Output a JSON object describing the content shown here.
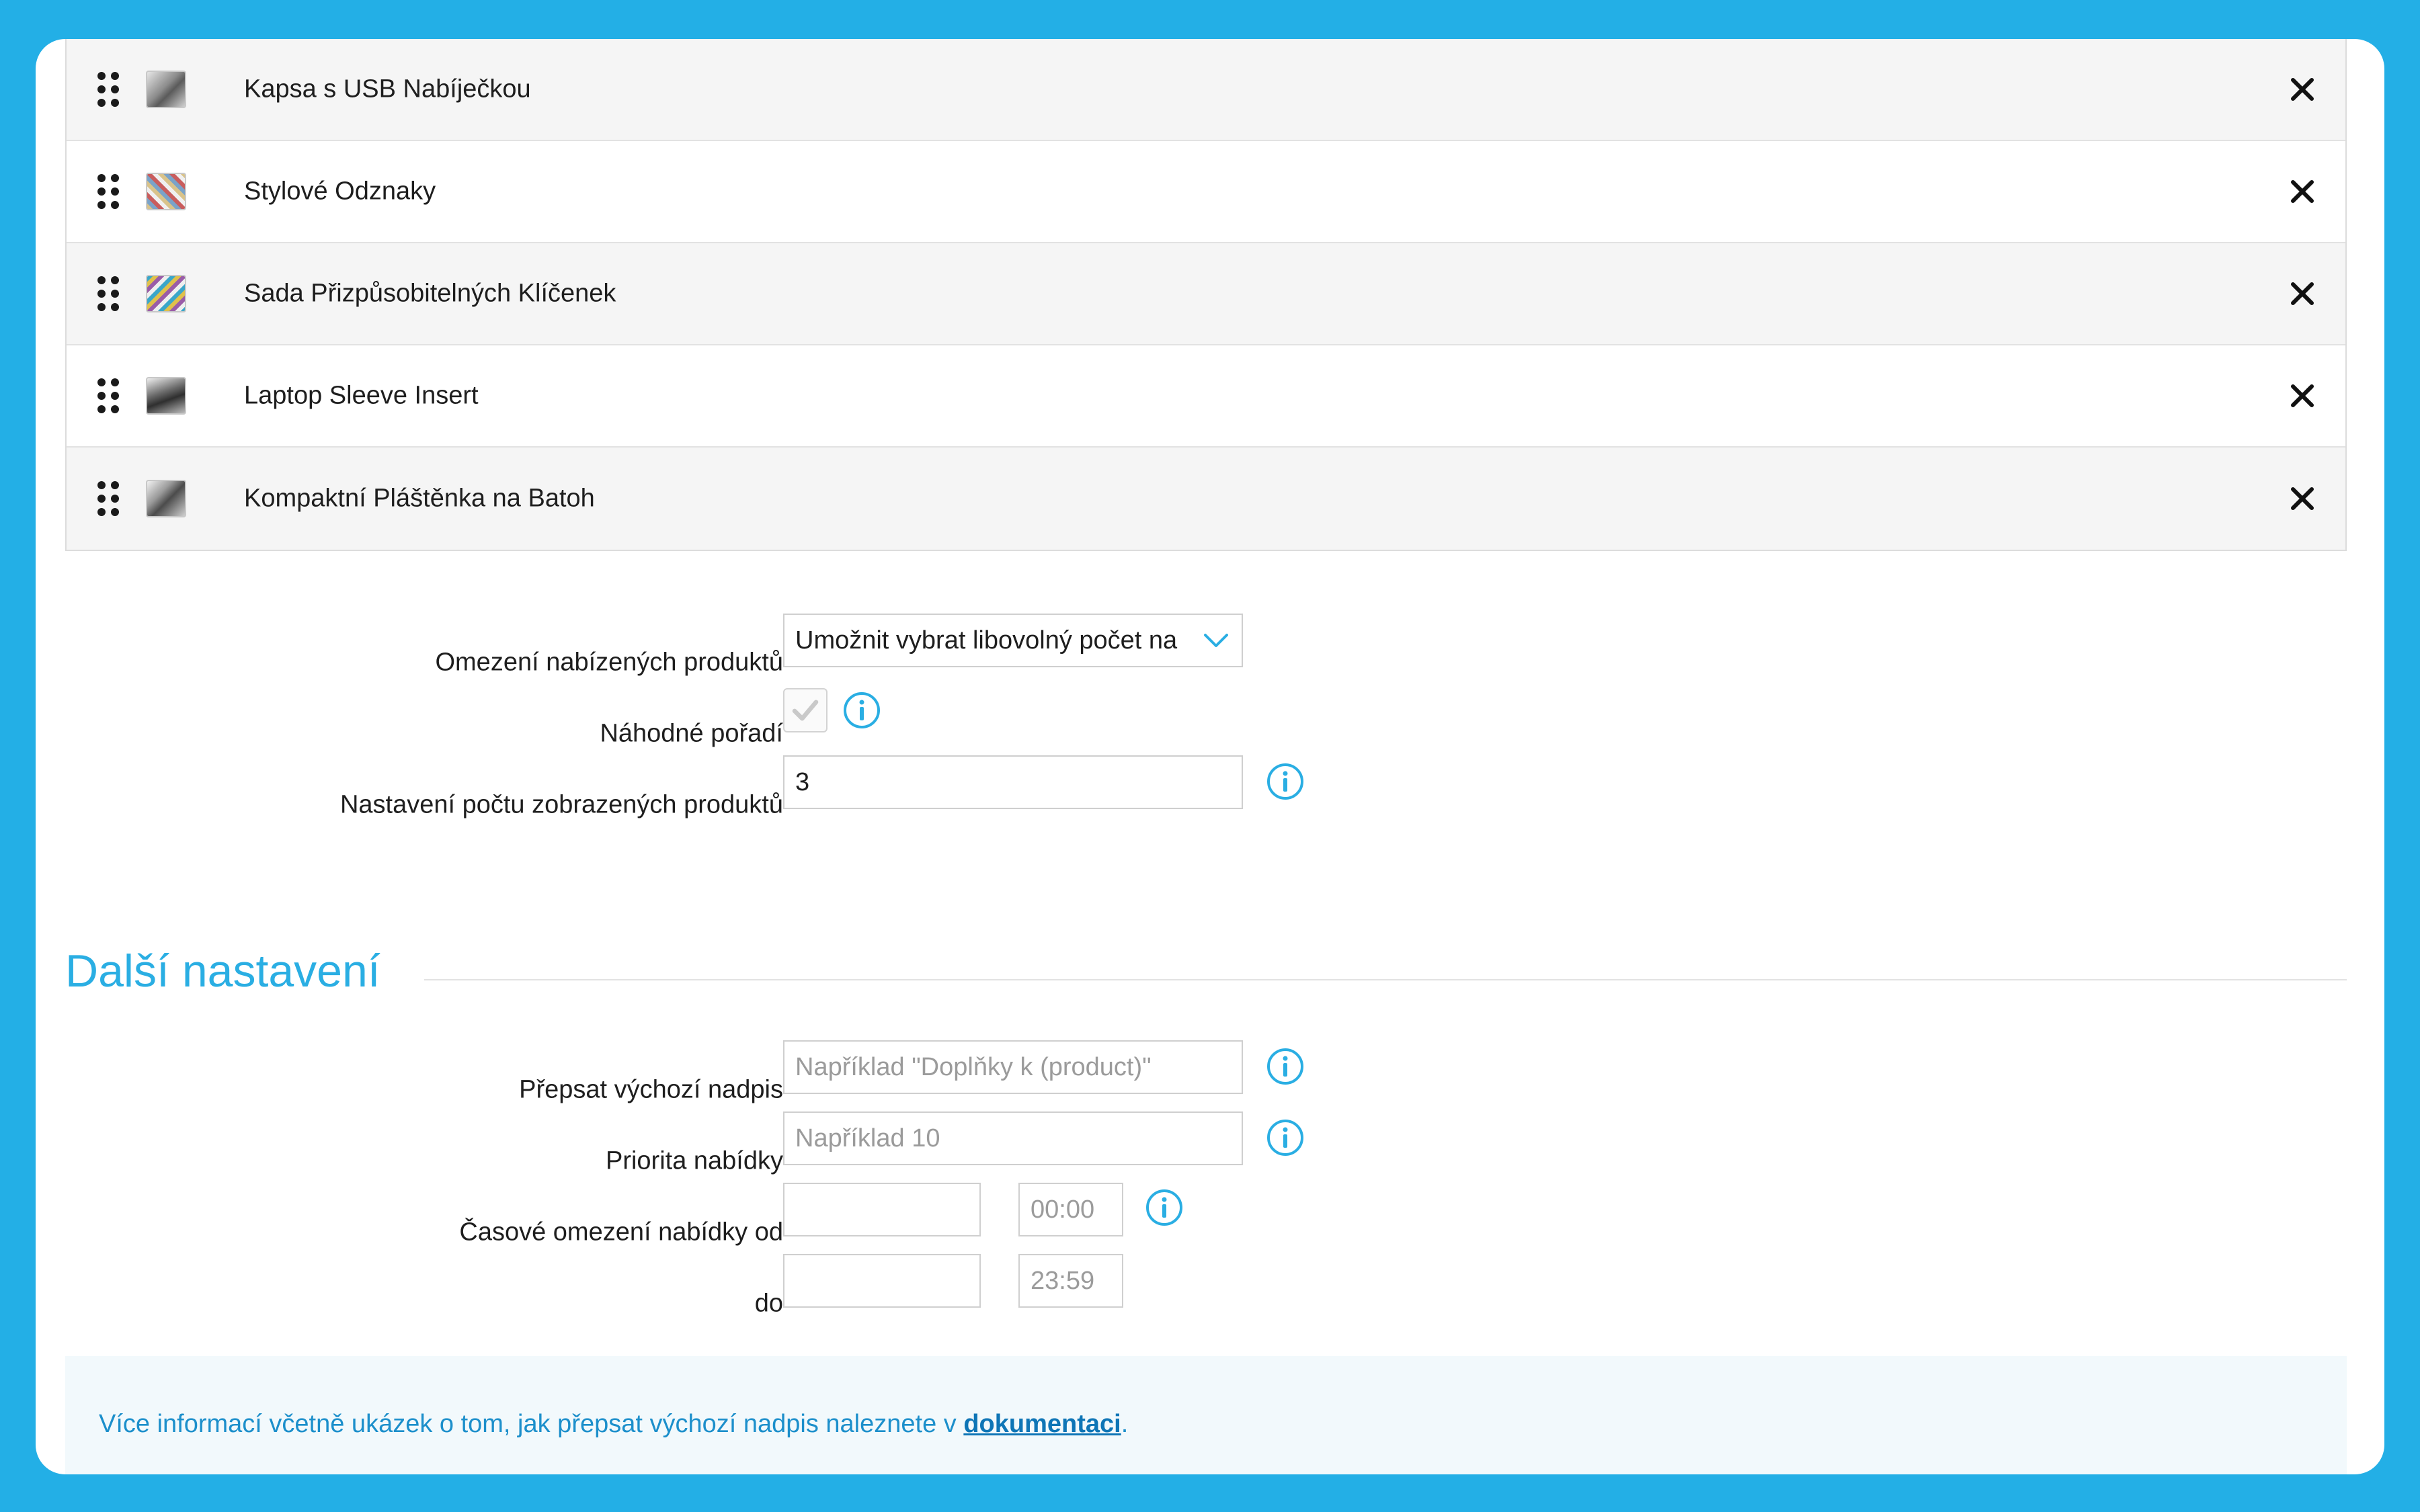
{
  "products": [
    {
      "name": "Kapsa s USB Nabíječkou",
      "thumb_icon": "usb-pocket-thumbnail"
    },
    {
      "name": "Stylové Odznaky",
      "thumb_icon": "badges-thumbnail"
    },
    {
      "name": "Sada Přizpůsobitelných Klíčenek",
      "thumb_icon": "keychains-thumbnail"
    },
    {
      "name": "Laptop Sleeve Insert",
      "thumb_icon": "laptop-sleeve-thumbnail"
    },
    {
      "name": "Kompaktní Pláštěnka na Batoh",
      "thumb_icon": "raincoat-thumbnail"
    }
  ],
  "limits": {
    "restriction_label": "Omezení nabízených produktů",
    "restriction_value": "Umožnit vybrat libovolný počet na",
    "random_order_label": "Náhodné pořadí",
    "random_order_checked": true,
    "display_count_label": "Nastavení počtu zobrazených produktů",
    "display_count_value": "3"
  },
  "more_settings": {
    "title": "Další nastavení",
    "override_heading_label": "Přepsat výchozí nadpis",
    "override_heading_placeholder": "Například \"Doplňky k (product)\"",
    "priority_label": "Priorita nabídky",
    "priority_placeholder": "Například 10",
    "time_from_label": "Časové omezení nabídky od",
    "time_from_time": "00:00",
    "time_to_label": "do",
    "time_to_time": "23:59"
  },
  "note": {
    "text": "Více informací včetně ukázek o tom, jak přepsat výchozí nadpis naleznete v ",
    "link": "dokumentaci",
    "suffix": "."
  },
  "colors": {
    "background": "#23AFE6",
    "accent": "#2AAEE3",
    "note_background": "#F2F9FC",
    "note_text": "#1C8FCB"
  }
}
